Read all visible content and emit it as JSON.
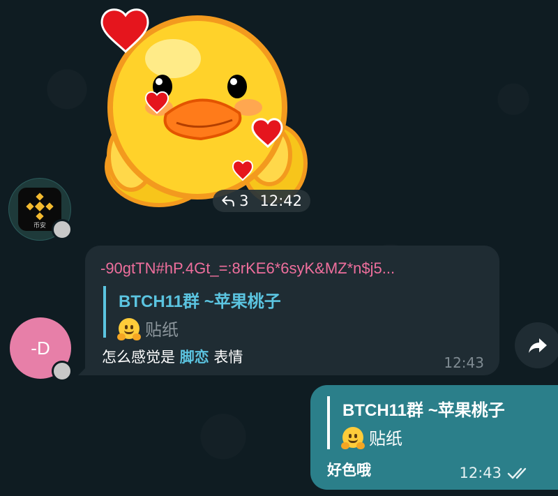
{
  "sticker": {
    "reply_count": "3",
    "time": "12:42",
    "icon": "reply-icon"
  },
  "avatars": {
    "binance": {
      "caption": "币安",
      "color": "#F3BA2F"
    },
    "d": {
      "initials": "-D",
      "color": "#e77fa8"
    }
  },
  "incoming": {
    "sender": "-90gtTN#hP.4Gt_=:8rKE6*6syK&MZ*n$j5...",
    "reply_title": "BTCH11群 ~苹果桃子",
    "reply_sub": "贴纸",
    "message_prefix": "怎么感觉是 ",
    "message_highlight": "脚恋",
    "message_suffix": " 表情",
    "time": "12:43"
  },
  "outgoing": {
    "reply_title": "BTCH11群 ~苹果桃子",
    "reply_sub": "贴纸",
    "message": "好色哦",
    "time": "12:43",
    "status_icon": "double-check-icon"
  },
  "colors": {
    "background": "#0f1c22",
    "incoming_bubble": "#1f2c33",
    "outgoing_bubble": "#2b7f8a",
    "accent": "#5bc4e0",
    "sender_name": "#ef6f9d"
  }
}
